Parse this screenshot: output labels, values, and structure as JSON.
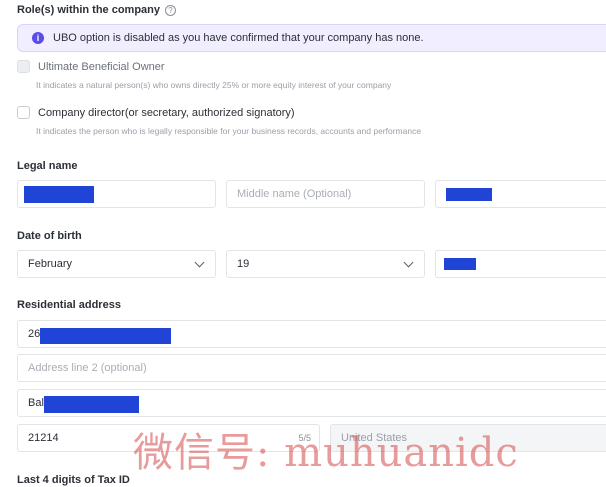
{
  "roles": {
    "label": "Role(s) within the company",
    "help_icon": "?",
    "notice_icon": "i",
    "notice": "UBO option is disabled as you have confirmed that your company has none.",
    "options": [
      {
        "label": "Ultimate Beneficial Owner",
        "description": "It indicates a natural person(s) who owns directly 25% or more equity interest of your company",
        "checked": false,
        "disabled": true
      },
      {
        "label": "Company director(or secretary, authorized signatory)",
        "description": "It indicates the person who is legally responsible for your business records, accounts and performance",
        "checked": false,
        "disabled": false
      }
    ]
  },
  "legal_name": {
    "label": "Legal name",
    "first_value": "",
    "middle_placeholder": "Middle name (Optional)",
    "last_value": ""
  },
  "date_of_birth": {
    "label": "Date of birth",
    "month": "February",
    "day": "19",
    "year": ""
  },
  "address": {
    "label": "Residential address",
    "line1_prefix": "26",
    "line2_placeholder": "Address line 2 (optional)",
    "city_prefix": "Bal",
    "zip": "21214",
    "zip_counter": "5/5",
    "country": "United States"
  },
  "tax_id": {
    "label": "Last 4 digits of Tax ID"
  },
  "watermark": "微信号: muhuanidc",
  "colors": {
    "accent": "#5b4ee8",
    "redaction": "#1f44d6",
    "notice_bg": "#f1efff"
  }
}
